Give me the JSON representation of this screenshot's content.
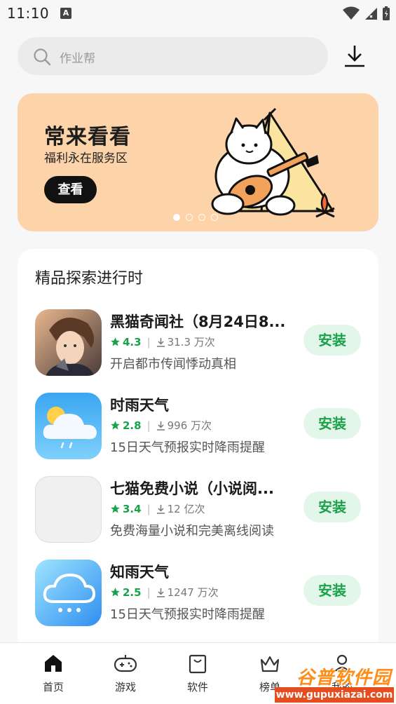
{
  "status_bar": {
    "time": "11:10",
    "notification_letter": "A"
  },
  "search": {
    "placeholder": "作业帮"
  },
  "banner": {
    "title": "常来看看",
    "subtitle": "福利永在服务区",
    "button_label": "查看",
    "page_count": 4,
    "active_page": 1,
    "background_color": "#fdd3a9"
  },
  "featured": {
    "title": "精品探索进行时",
    "apps": [
      {
        "name": "黑猫奇闻社（8月24日8...",
        "rating": "4.3",
        "downloads": "31.3 万次",
        "description": "开启都市传闻悸动真相",
        "install_label": "安装",
        "icon": "character-portrait-icon"
      },
      {
        "name": "时雨天气",
        "rating": "2.8",
        "downloads": "996 万次",
        "description": "15日天气预报实时降雨提醒",
        "install_label": "安装",
        "icon": "weather-sun-cloud-icon"
      },
      {
        "name": "七猫免费小说（小说阅...",
        "rating": "3.4",
        "downloads": "12 亿次",
        "description": "免费海量小说和完美离线阅读",
        "install_label": "安装",
        "icon": "placeholder-icon"
      },
      {
        "name": "知雨天气",
        "rating": "2.5",
        "downloads": "1247 万次",
        "description": "15日天气预报实时降雨提醒",
        "install_label": "安装",
        "icon": "rain-cloud-icon"
      }
    ]
  },
  "tabs": [
    {
      "label": "首页",
      "icon": "home-icon",
      "active": true
    },
    {
      "label": "游戏",
      "icon": "gamepad-icon"
    },
    {
      "label": "软件",
      "icon": "shopping-bag-icon"
    },
    {
      "label": "榜单",
      "icon": "crown-icon"
    },
    {
      "label": "我的",
      "icon": "person-icon"
    }
  ],
  "watermark": {
    "name": "谷普软件园",
    "url": "www.gupuxiazai.com"
  },
  "colors": {
    "accent_green": "#1aa24a",
    "install_bg": "#e3f6ea",
    "page_bg": "#f7f7f7"
  }
}
